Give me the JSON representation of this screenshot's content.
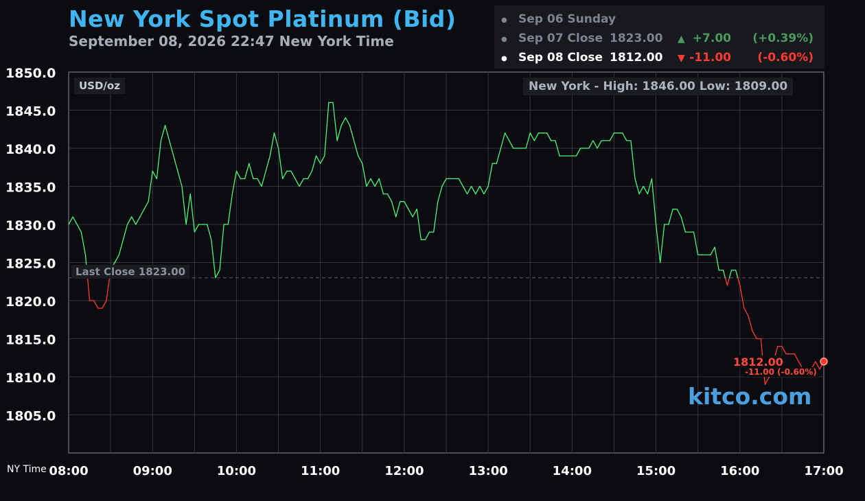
{
  "header": {
    "title": "New York Spot Platinum (Bid)",
    "subtitle": "September 08, 2026 22:47 New York Time"
  },
  "legend": [
    {
      "date": "Sep 06 Sunday",
      "price": "",
      "arrow": "",
      "change": "",
      "pct": "",
      "style": "muted"
    },
    {
      "date": "Sep 07 Close",
      "price": "1823.00",
      "arrow": "▲",
      "change": "+7.00",
      "pct": "(+0.39%)",
      "style": "up"
    },
    {
      "date": "Sep 08 Close",
      "price": "1812.00",
      "arrow": "▼",
      "change": "-11.00",
      "pct": "(-0.60%)",
      "style": "down"
    }
  ],
  "unit_label": "USD/oz",
  "hilo": "New York - High: 1846.00   Low: 1809.00",
  "last_close_label": "Last Close 1823.00",
  "x_axis_title": "NY Time",
  "end_label": {
    "price": "1812.00",
    "change": "-11.00 (-0.60%)"
  },
  "watermark": "kitco.com",
  "colors": {
    "up": "#4cf57a",
    "down": "#ff3b30",
    "grid": "#34363c",
    "background": "#0b0c10"
  },
  "chart_data": {
    "type": "line",
    "ylim": [
      1800,
      1850
    ],
    "xlim": [
      8,
      17
    ],
    "yticks": [
      1850,
      1845,
      1840,
      1835,
      1830,
      1825,
      1820,
      1815,
      1810,
      1805
    ],
    "ytick_labels": [
      "1850.0",
      "1845.0",
      "1840.0",
      "1835.0",
      "1830.0",
      "1825.0",
      "1820.0",
      "1815.0",
      "1810.0",
      "1805.0"
    ],
    "xticks": [
      8,
      9,
      10,
      11,
      12,
      13,
      14,
      15,
      16,
      17
    ],
    "xtick_labels": [
      "08:00",
      "09:00",
      "10:00",
      "11:00",
      "12:00",
      "13:00",
      "14:00",
      "15:00",
      "16:00",
      "17:00"
    ],
    "baseline": 1823,
    "grid": true,
    "series": [
      {
        "points": [
          [
            8.0,
            1830
          ],
          [
            8.05,
            1831
          ],
          [
            8.15,
            1829
          ],
          [
            8.2,
            1826
          ],
          [
            8.25,
            1820
          ],
          [
            8.3,
            1820
          ],
          [
            8.35,
            1819
          ],
          [
            8.4,
            1819
          ],
          [
            8.45,
            1820
          ],
          [
            8.5,
            1824
          ],
          [
            8.55,
            1825
          ],
          [
            8.6,
            1826
          ],
          [
            8.65,
            1828
          ],
          [
            8.7,
            1830
          ],
          [
            8.75,
            1831
          ],
          [
            8.8,
            1830
          ],
          [
            8.85,
            1831
          ],
          [
            8.9,
            1832
          ],
          [
            8.95,
            1833
          ],
          [
            9.0,
            1837
          ],
          [
            9.05,
            1836
          ],
          [
            9.1,
            1841
          ],
          [
            9.15,
            1843
          ],
          [
            9.2,
            1841
          ],
          [
            9.25,
            1839
          ],
          [
            9.3,
            1837
          ],
          [
            9.35,
            1835
          ],
          [
            9.4,
            1830
          ],
          [
            9.45,
            1834
          ],
          [
            9.5,
            1829
          ],
          [
            9.55,
            1830
          ],
          [
            9.6,
            1830
          ],
          [
            9.65,
            1830
          ],
          [
            9.7,
            1828
          ],
          [
            9.75,
            1823
          ],
          [
            9.8,
            1824
          ],
          [
            9.85,
            1830
          ],
          [
            9.9,
            1830
          ],
          [
            9.95,
            1834
          ],
          [
            10.0,
            1837
          ],
          [
            10.05,
            1836
          ],
          [
            10.1,
            1836
          ],
          [
            10.15,
            1838
          ],
          [
            10.2,
            1836
          ],
          [
            10.25,
            1836
          ],
          [
            10.3,
            1835
          ],
          [
            10.35,
            1837
          ],
          [
            10.4,
            1839
          ],
          [
            10.45,
            1842
          ],
          [
            10.5,
            1840
          ],
          [
            10.55,
            1836
          ],
          [
            10.6,
            1837
          ],
          [
            10.65,
            1837
          ],
          [
            10.7,
            1836
          ],
          [
            10.75,
            1835
          ],
          [
            10.8,
            1836
          ],
          [
            10.85,
            1836
          ],
          [
            10.9,
            1837
          ],
          [
            10.95,
            1839
          ],
          [
            11.0,
            1838
          ],
          [
            11.05,
            1839
          ],
          [
            11.1,
            1846
          ],
          [
            11.15,
            1846
          ],
          [
            11.2,
            1841
          ],
          [
            11.25,
            1843
          ],
          [
            11.3,
            1844
          ],
          [
            11.35,
            1843
          ],
          [
            11.4,
            1841
          ],
          [
            11.45,
            1839
          ],
          [
            11.5,
            1838
          ],
          [
            11.55,
            1835
          ],
          [
            11.6,
            1836
          ],
          [
            11.65,
            1835
          ],
          [
            11.7,
            1836
          ],
          [
            11.75,
            1834
          ],
          [
            11.8,
            1834
          ],
          [
            11.85,
            1833
          ],
          [
            11.9,
            1831
          ],
          [
            11.95,
            1833
          ],
          [
            12.0,
            1833
          ],
          [
            12.05,
            1832
          ],
          [
            12.1,
            1831
          ],
          [
            12.15,
            1832
          ],
          [
            12.2,
            1828
          ],
          [
            12.25,
            1828
          ],
          [
            12.3,
            1829
          ],
          [
            12.35,
            1829
          ],
          [
            12.4,
            1833
          ],
          [
            12.45,
            1835
          ],
          [
            12.5,
            1836
          ],
          [
            12.55,
            1836
          ],
          [
            12.6,
            1836
          ],
          [
            12.65,
            1836
          ],
          [
            12.7,
            1835
          ],
          [
            12.75,
            1834
          ],
          [
            12.8,
            1835
          ],
          [
            12.85,
            1834
          ],
          [
            12.9,
            1835
          ],
          [
            12.95,
            1834
          ],
          [
            13.0,
            1835
          ],
          [
            13.05,
            1838
          ],
          [
            13.1,
            1838
          ],
          [
            13.15,
            1840
          ],
          [
            13.2,
            1842
          ],
          [
            13.25,
            1841
          ],
          [
            13.3,
            1840
          ],
          [
            13.35,
            1840
          ],
          [
            13.4,
            1840
          ],
          [
            13.45,
            1840
          ],
          [
            13.5,
            1842
          ],
          [
            13.55,
            1841
          ],
          [
            13.6,
            1842
          ],
          [
            13.65,
            1842
          ],
          [
            13.7,
            1842
          ],
          [
            13.75,
            1841
          ],
          [
            13.8,
            1841
          ],
          [
            13.85,
            1839
          ],
          [
            13.9,
            1839
          ],
          [
            13.95,
            1839
          ],
          [
            14.0,
            1839
          ],
          [
            14.05,
            1839
          ],
          [
            14.1,
            1840
          ],
          [
            14.15,
            1840
          ],
          [
            14.2,
            1840
          ],
          [
            14.25,
            1841
          ],
          [
            14.3,
            1840
          ],
          [
            14.35,
            1841
          ],
          [
            14.4,
            1841
          ],
          [
            14.45,
            1841
          ],
          [
            14.5,
            1842
          ],
          [
            14.55,
            1842
          ],
          [
            14.6,
            1842
          ],
          [
            14.65,
            1841
          ],
          [
            14.7,
            1841
          ],
          [
            14.75,
            1836
          ],
          [
            14.8,
            1834
          ],
          [
            14.85,
            1835
          ],
          [
            14.9,
            1834
          ],
          [
            14.95,
            1836
          ],
          [
            15.0,
            1830
          ],
          [
            15.05,
            1825
          ],
          [
            15.1,
            1830
          ],
          [
            15.15,
            1830
          ],
          [
            15.2,
            1832
          ],
          [
            15.25,
            1832
          ],
          [
            15.3,
            1831
          ],
          [
            15.35,
            1829
          ],
          [
            15.4,
            1829
          ],
          [
            15.45,
            1829
          ],
          [
            15.5,
            1826
          ],
          [
            15.55,
            1826
          ],
          [
            15.6,
            1826
          ],
          [
            15.65,
            1826
          ],
          [
            15.7,
            1827
          ],
          [
            15.75,
            1824
          ],
          [
            15.8,
            1824
          ],
          [
            15.85,
            1822
          ],
          [
            15.9,
            1824
          ],
          [
            15.95,
            1824
          ],
          [
            16.0,
            1822
          ],
          [
            16.05,
            1819
          ],
          [
            16.1,
            1818
          ],
          [
            16.15,
            1816
          ],
          [
            16.2,
            1815
          ],
          [
            16.25,
            1815
          ],
          [
            16.3,
            1809
          ],
          [
            16.35,
            1810
          ],
          [
            16.4,
            1812
          ],
          [
            16.45,
            1814
          ],
          [
            16.5,
            1814
          ],
          [
            16.55,
            1813
          ],
          [
            16.6,
            1813
          ],
          [
            16.65,
            1813
          ],
          [
            16.7,
            1812
          ],
          [
            16.75,
            1811
          ],
          [
            16.8,
            1811
          ],
          [
            16.85,
            1811
          ],
          [
            16.9,
            1812
          ],
          [
            16.95,
            1811
          ],
          [
            17.0,
            1812
          ]
        ]
      }
    ]
  }
}
